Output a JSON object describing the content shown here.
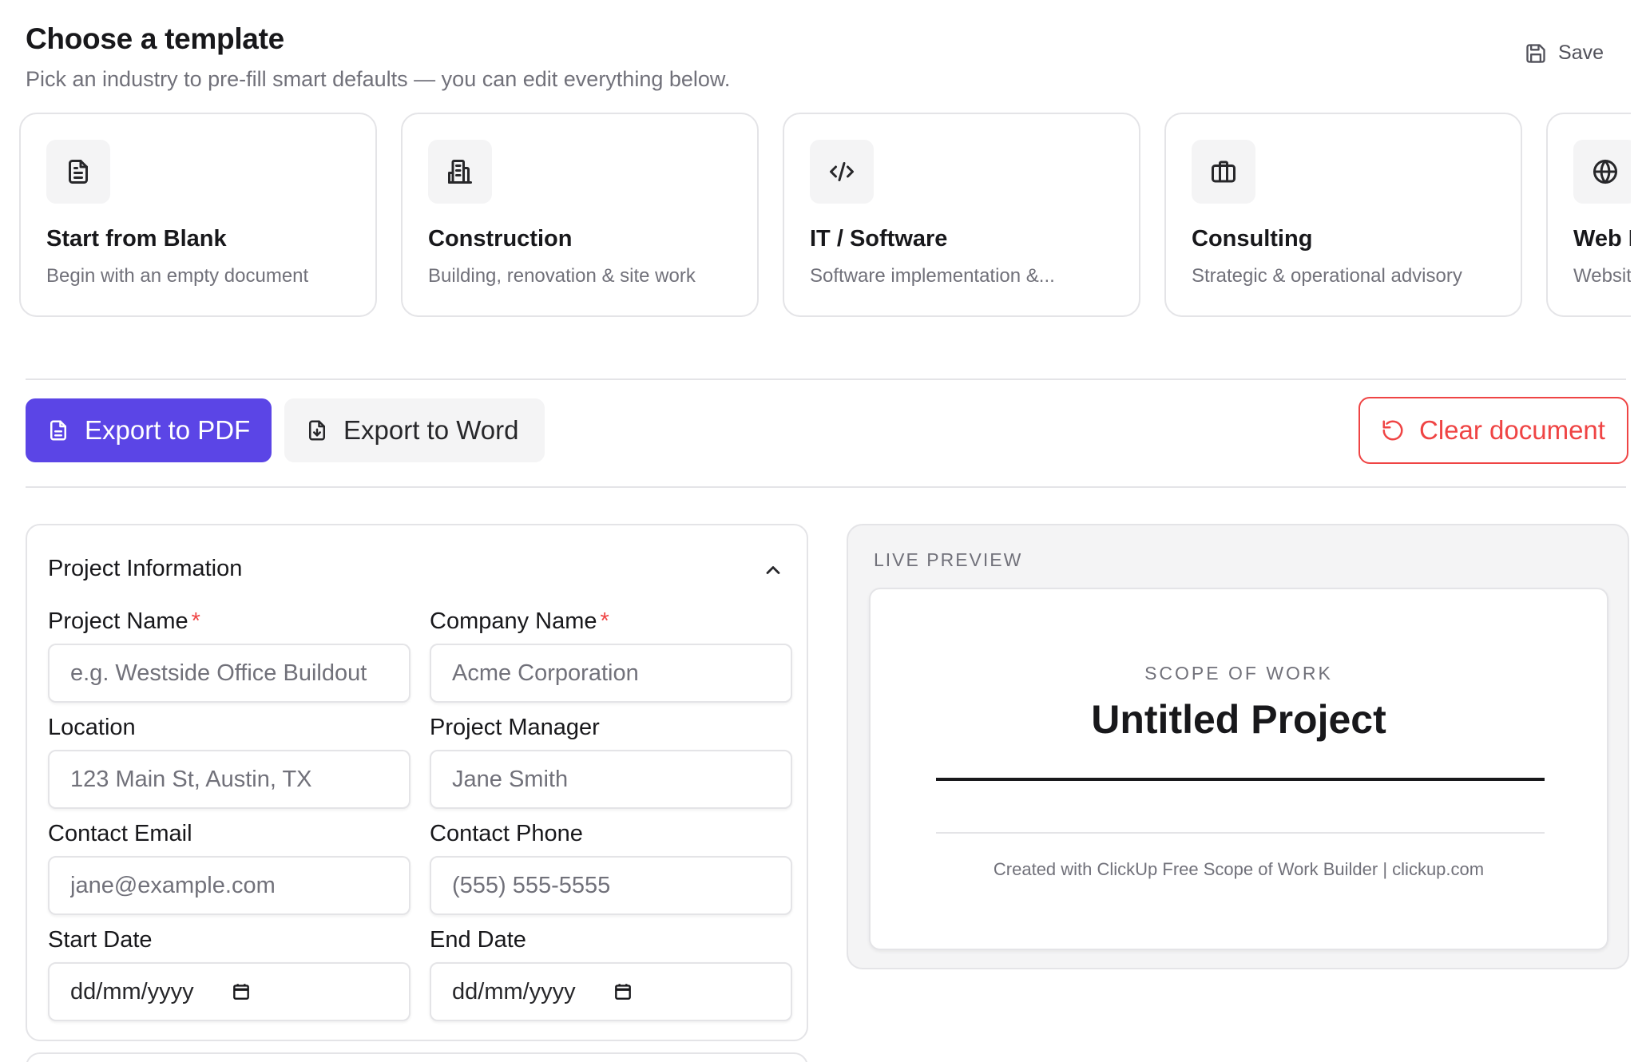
{
  "header": {
    "title": "Choose a template",
    "subtitle": "Pick an industry to pre-fill smart defaults — you can edit everything below.",
    "save_label": "Save"
  },
  "templates": [
    {
      "icon": "document-icon",
      "name": "Start from Blank",
      "desc": "Begin with an empty document"
    },
    {
      "icon": "building-icon",
      "name": "Construction",
      "desc": "Building, renovation & site work"
    },
    {
      "icon": "code-icon",
      "name": "IT / Software",
      "desc": "Software implementation &..."
    },
    {
      "icon": "briefcase-icon",
      "name": "Consulting",
      "desc": "Strategic & operational advisory"
    },
    {
      "icon": "globe-icon",
      "name": "Web De",
      "desc": "Website"
    }
  ],
  "actions": {
    "export_pdf": "Export to PDF",
    "export_word": "Export to Word",
    "clear": "Clear document"
  },
  "colors": {
    "accent": "#5b45e6",
    "danger": "#ef4444"
  },
  "project_info": {
    "heading": "Project Information",
    "required_mark": "*",
    "project_name": {
      "label": "Project Name",
      "placeholder": "e.g. Westside Office Buildout"
    },
    "company_name": {
      "label": "Company Name",
      "placeholder": "Acme Corporation"
    },
    "location": {
      "label": "Location",
      "placeholder": "123 Main St, Austin, TX"
    },
    "project_manager": {
      "label": "Project Manager",
      "placeholder": "Jane Smith"
    },
    "contact_email": {
      "label": "Contact Email",
      "placeholder": "jane@example.com"
    },
    "contact_phone": {
      "label": "Contact Phone",
      "placeholder": "(555) 555-5555"
    },
    "start_date": {
      "label": "Start Date",
      "value": "dd/mm/yyyy"
    },
    "end_date": {
      "label": "End Date",
      "value": "dd/mm/yyyy"
    }
  },
  "preview": {
    "label": "LIVE PREVIEW",
    "kicker": "SCOPE OF WORK",
    "title": "Untitled Project",
    "footer": "Created with ClickUp Free Scope of Work Builder | clickup.com"
  }
}
